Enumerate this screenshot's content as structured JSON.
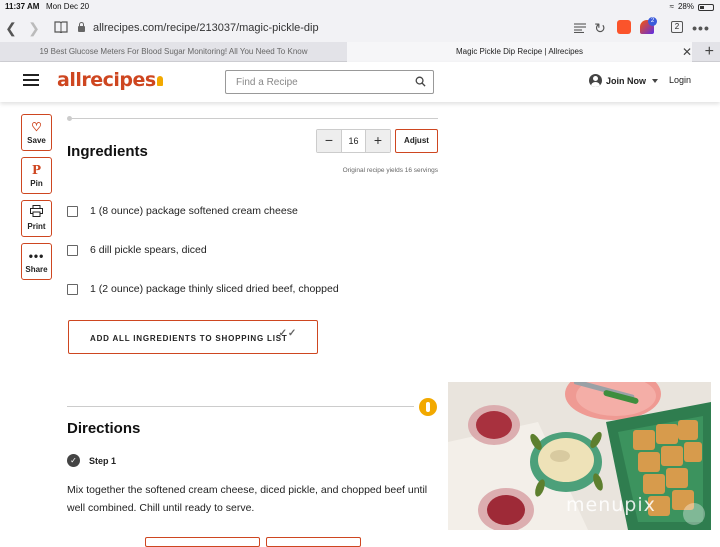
{
  "status_bar": {
    "time": "11:37 AM",
    "date": "Mon Dec 20",
    "battery": "28%"
  },
  "browser": {
    "url": "allrecipes.com/recipe/213037/magic-pickle-dip",
    "tab_count": "2",
    "brave_badge": "2",
    "tabs": [
      {
        "title": "19 Best Glucose Meters For Blood Sugar Monitoring! All You Need To Know",
        "active": false
      },
      {
        "title": "Magic Pickle Dip Recipe | Allrecipes",
        "active": true
      }
    ]
  },
  "header": {
    "logo": "allrecipes",
    "search_placeholder": "Find a Recipe",
    "join_label": "Join Now",
    "login_label": "Login"
  },
  "share_rail": [
    {
      "label": "Save",
      "icon": "heart-icon"
    },
    {
      "label": "Pin",
      "icon": "pinterest-icon"
    },
    {
      "label": "Print",
      "icon": "print-icon"
    },
    {
      "label": "Share",
      "icon": "more-icon"
    }
  ],
  "ingredients": {
    "heading": "Ingredients",
    "servings": "16",
    "adjust_label": "Adjust",
    "yield_note": "Original recipe yields 16 servings",
    "items": [
      "1 (8 ounce) package softened cream cheese",
      "6 dill pickle spears, diced",
      "1 (2 ounce) package thinly sliced dried beef, chopped"
    ],
    "shopping_button": "ADD ALL INGREDIENTS TO SHOPPING LIST"
  },
  "directions": {
    "heading": "Directions",
    "steps": [
      {
        "label": "Step 1",
        "text": "Mix together the softened cream cheese, diced pickle, and chopped beef until well combined. Chill until ready to serve."
      }
    ]
  },
  "photo": {
    "watermark": "menupix"
  },
  "colors": {
    "brand": "#ce4620",
    "accent": "#f2a900"
  }
}
